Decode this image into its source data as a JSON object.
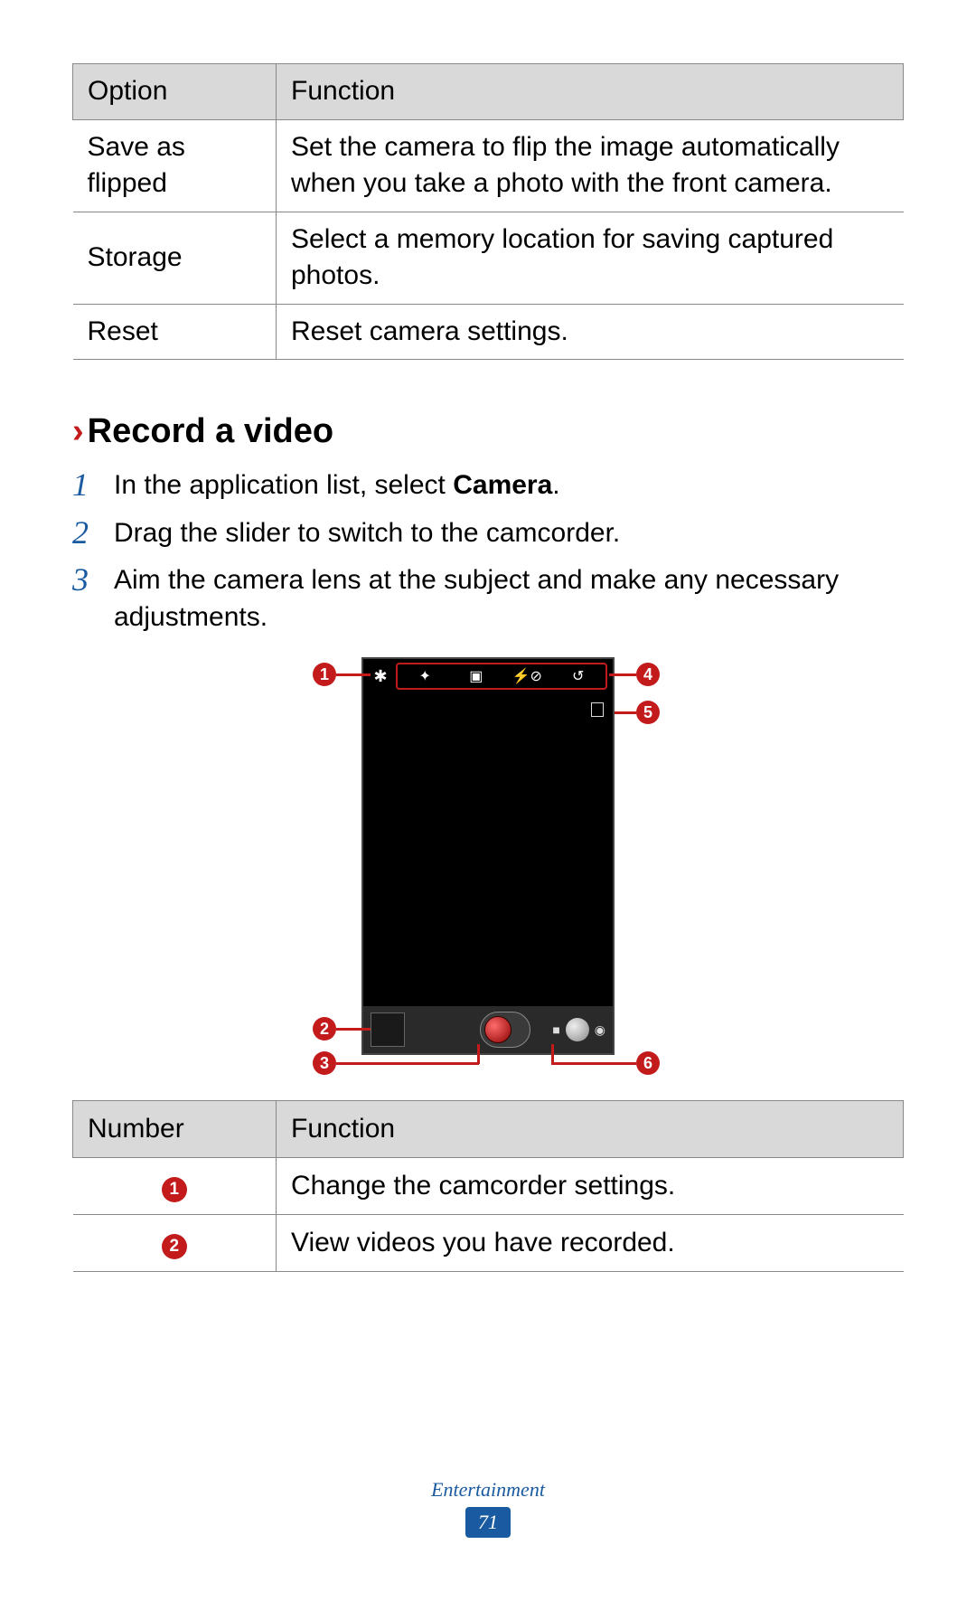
{
  "table1": {
    "head": {
      "c1": "Option",
      "c2": "Function"
    },
    "rows": [
      {
        "c1": "Save as flipped",
        "c2": "Set the camera to flip the image automatically when you take a photo with the front camera."
      },
      {
        "c1": "Storage",
        "c2": "Select a memory location for saving captured photos."
      },
      {
        "c1": "Reset",
        "c2": "Reset camera settings."
      }
    ]
  },
  "section": {
    "chevron": "›",
    "title": "Record a video"
  },
  "steps": [
    {
      "n": "1",
      "before": "In the application list, select ",
      "bold": "Camera",
      "after": "."
    },
    {
      "n": "2",
      "before": "Drag the slider to switch to the camcorder.",
      "bold": "",
      "after": ""
    },
    {
      "n": "3",
      "before": "Aim the camera lens at the subject and make any necessary adjustments.",
      "bold": "",
      "after": ""
    }
  ],
  "callouts": {
    "c1": "1",
    "c2": "2",
    "c3": "3",
    "c4": "4",
    "c5": "5",
    "c6": "6"
  },
  "table2": {
    "head": {
      "c1": "Number",
      "c2": "Function"
    },
    "rows": [
      {
        "n": "1",
        "c2": "Change the camcorder settings."
      },
      {
        "n": "2",
        "c2": "View videos you have recorded."
      }
    ]
  },
  "footer": {
    "section": "Entertainment",
    "page": "71"
  }
}
